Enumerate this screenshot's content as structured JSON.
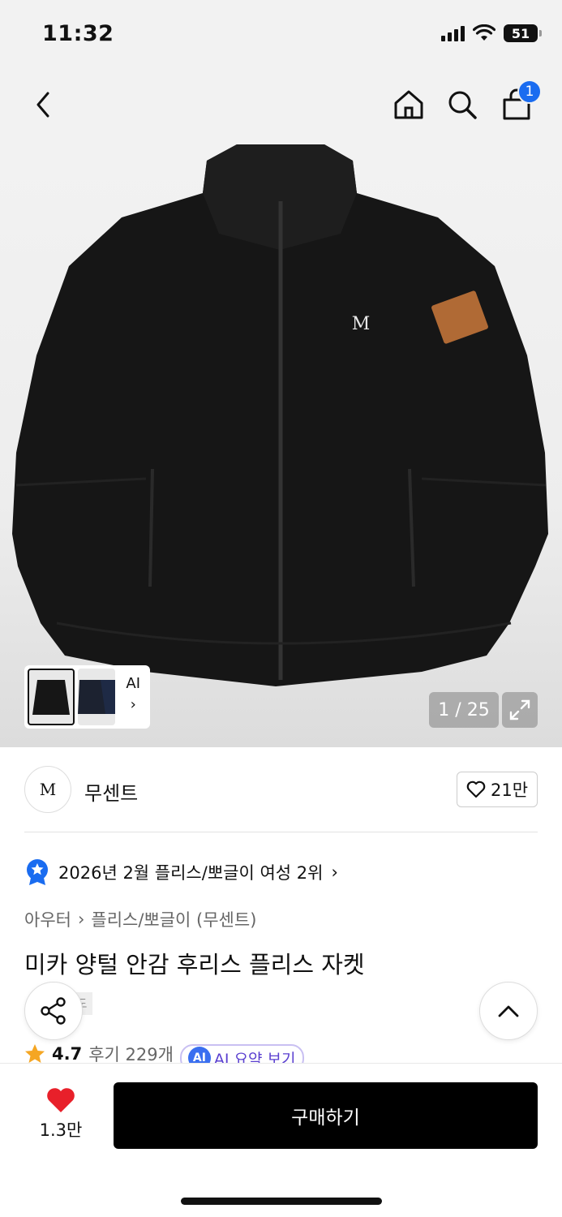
{
  "status_bar": {
    "time": "11:32",
    "battery": "51"
  },
  "nav": {
    "cart_count": "1"
  },
  "gallery": {
    "ai_label": "AI",
    "ai_arrow": "›",
    "page_counter": "1 / 25"
  },
  "brand": {
    "logo_text": "M",
    "name": "무센트",
    "like_count": "21만"
  },
  "ranking": {
    "text": "2026년 2월 플리스/뽀글이 여성 2위",
    "arrow": "›"
  },
  "breadcrumb": {
    "category": "아우터",
    "separator": "›",
    "subcategory": "플리스/뽀글이 (무센트)"
  },
  "product": {
    "title": "미카 양털 안감 후리스 플리스 자켓",
    "coupon_text": "도"
  },
  "rating": {
    "value": "4.7",
    "review_label": "후기 229개",
    "ai_badge": "AI",
    "ai_summary_label": "AI 요약 보기"
  },
  "bottom": {
    "wish_count": "1.3만",
    "buy_label": "구매하기"
  },
  "colors": {
    "accent_blue": "#1a6cf0",
    "heart_red": "#e8202a",
    "star_orange": "#f5a623",
    "ai_purple": "#5a3fd0"
  }
}
